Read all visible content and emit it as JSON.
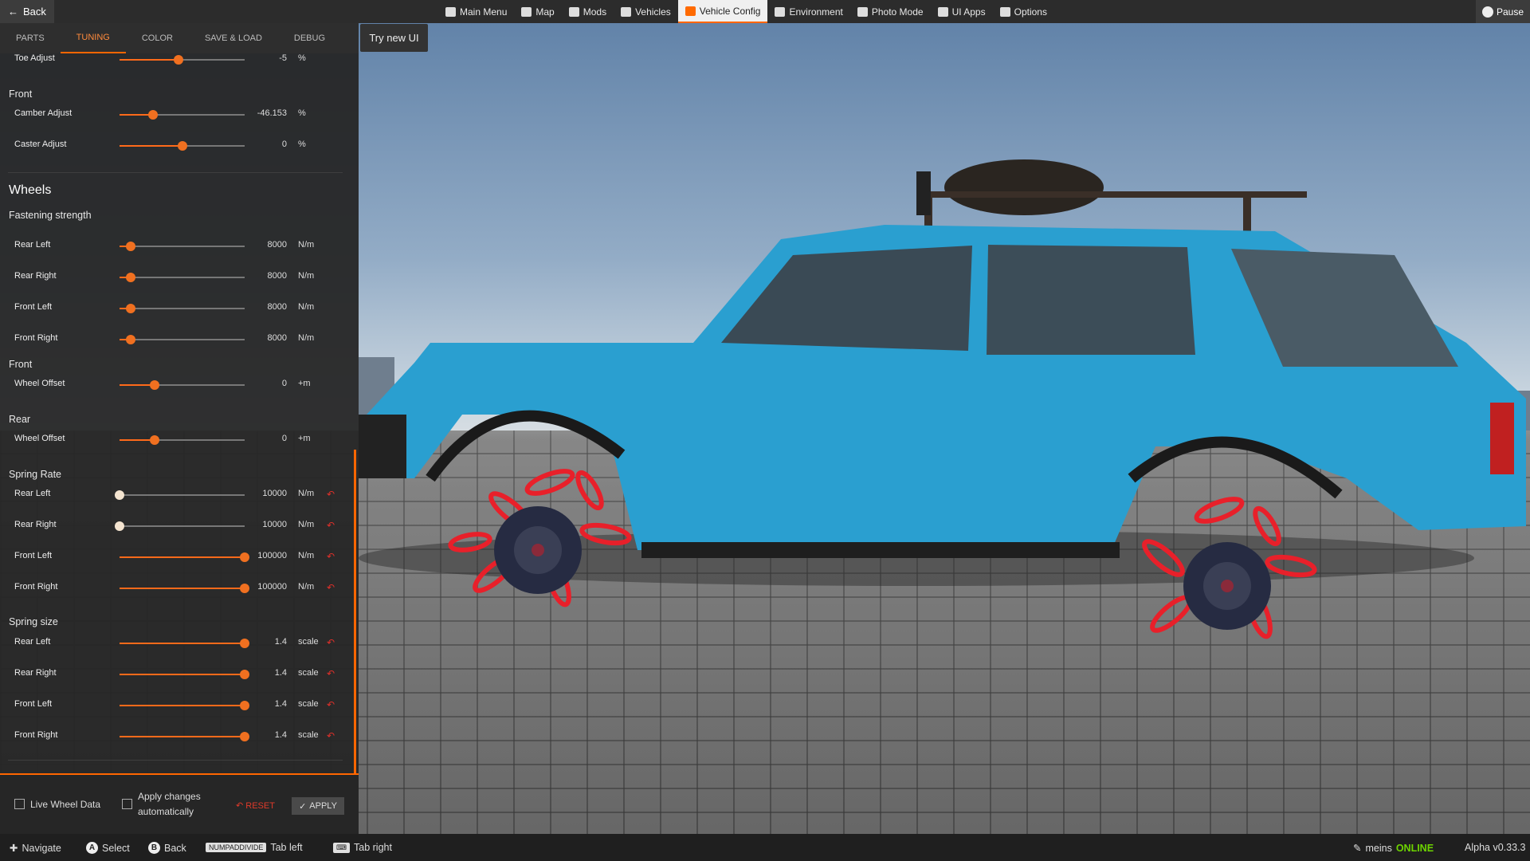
{
  "topbar": {
    "back": "Back",
    "nav": [
      {
        "label": "Main Menu",
        "icon": "grid-icon"
      },
      {
        "label": "Map",
        "icon": "map-icon"
      },
      {
        "label": "Mods",
        "icon": "puzzle-icon"
      },
      {
        "label": "Vehicles",
        "icon": "car-icon"
      },
      {
        "label": "Vehicle Config",
        "icon": "wrench-icon",
        "active": true
      },
      {
        "label": "Environment",
        "icon": "weather-icon"
      },
      {
        "label": "Photo Mode",
        "icon": "camera-icon"
      },
      {
        "label": "UI Apps",
        "icon": "apps-icon"
      },
      {
        "label": "Options",
        "icon": "sliders-icon"
      }
    ],
    "pause": "Pause"
  },
  "tabs": [
    "PARTS",
    "TUNING",
    "COLOR",
    "SAVE & LOAD",
    "DEBUG"
  ],
  "try_new_ui": "Try new UI",
  "settings": {
    "toe_adjust": {
      "label": "Toe Adjust",
      "value": "-5",
      "unit": "%",
      "fraction": 0.47
    },
    "front_section": "Front",
    "camber_adjust": {
      "label": "Camber Adjust",
      "value": "-46.153",
      "unit": "%",
      "fraction": 0.27
    },
    "caster_adjust": {
      "label": "Caster Adjust",
      "value": "0",
      "unit": "%",
      "fraction": 0.5
    },
    "wheels_heading": "Wheels",
    "fastening_heading": "Fastening strength",
    "fastening": [
      {
        "label": "Rear Left",
        "value": "8000",
        "unit": "N/m",
        "fraction": 0.09
      },
      {
        "label": "Rear Right",
        "value": "8000",
        "unit": "N/m",
        "fraction": 0.09
      },
      {
        "label": "Front Left",
        "value": "8000",
        "unit": "N/m",
        "fraction": 0.09
      },
      {
        "label": "Front Right",
        "value": "8000",
        "unit": "N/m",
        "fraction": 0.09
      }
    ],
    "front_offset_heading": "Front",
    "front_wheel_offset": {
      "label": "Wheel Offset",
      "value": "0",
      "unit": "+m",
      "fraction": 0.28
    },
    "rear_offset_heading": "Rear",
    "rear_wheel_offset": {
      "label": "Wheel Offset",
      "value": "0",
      "unit": "+m",
      "fraction": 0.28
    },
    "spring_rate_heading": "Spring Rate",
    "spring_rate": [
      {
        "label": "Rear Left",
        "value": "10000",
        "unit": "N/m",
        "fraction": 0.0
      },
      {
        "label": "Rear Right",
        "value": "10000",
        "unit": "N/m",
        "fraction": 0.0
      },
      {
        "label": "Front Left",
        "value": "100000",
        "unit": "N/m",
        "fraction": 1.0
      },
      {
        "label": "Front Right",
        "value": "100000",
        "unit": "N/m",
        "fraction": 1.0
      }
    ],
    "spring_size_heading": "Spring size",
    "spring_size": [
      {
        "label": "Rear Left",
        "value": "1.4",
        "unit": "scale",
        "fraction": 1.0
      },
      {
        "label": "Rear Right",
        "value": "1.4",
        "unit": "scale",
        "fraction": 1.0
      },
      {
        "label": "Front Left",
        "value": "1.4",
        "unit": "scale",
        "fraction": 1.0
      },
      {
        "label": "Front Right",
        "value": "1.4",
        "unit": "scale",
        "fraction": 1.0
      }
    ]
  },
  "footer": {
    "live_wheel_data": "Live Wheel Data",
    "apply_auto_line1": "Apply changes",
    "apply_auto_line2": "automatically",
    "reset": "RESET",
    "apply": "APPLY"
  },
  "bottombar": {
    "navigate": "Navigate",
    "select_key": "A",
    "select": "Select",
    "back_key": "B",
    "back": "Back",
    "tab_left_key": "NUMPADDIVIDE",
    "tab_left": "Tab left",
    "tab_right": "Tab right",
    "user": "meins",
    "status": "ONLINE",
    "version": "Alpha v0.33.3"
  },
  "colors": {
    "accent": "#ff6600",
    "online": "#6dd400",
    "car": "#2a9fd0",
    "spring": "#e8202a"
  }
}
